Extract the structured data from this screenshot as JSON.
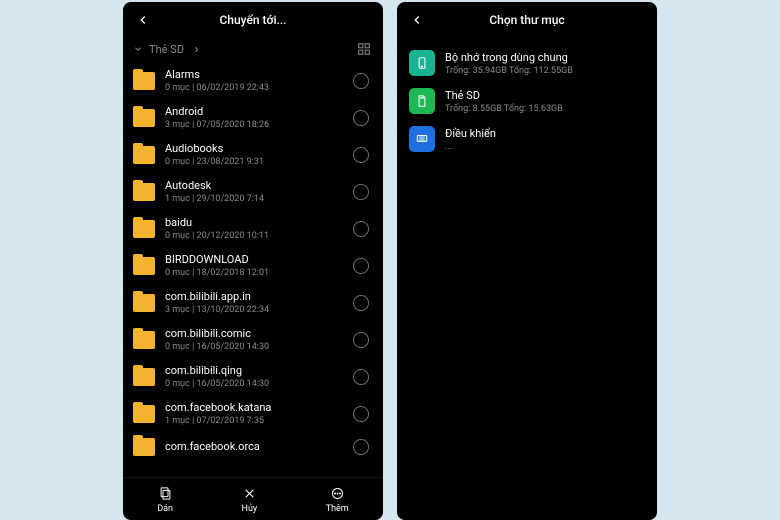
{
  "left": {
    "title": "Chuyển tới...",
    "breadcrumb": "Thẻ SD",
    "folders": [
      {
        "name": "Alarms",
        "meta": "0 mục | 06/02/2019 22:43"
      },
      {
        "name": "Android",
        "meta": "3 mục | 07/05/2020 18:26"
      },
      {
        "name": "Audiobooks",
        "meta": "0 mục | 23/08/2021 9:31"
      },
      {
        "name": "Autodesk",
        "meta": "1 mục | 29/10/2020 7:14"
      },
      {
        "name": "baidu",
        "meta": "0 mục | 20/12/2020 10:11"
      },
      {
        "name": "BIRDDOWNLOAD",
        "meta": "0 mục | 18/02/2018 12:01"
      },
      {
        "name": "com.bilibili.app.in",
        "meta": "3 mục | 13/10/2020 22:34"
      },
      {
        "name": "com.bilibili.comic",
        "meta": "0 mục | 16/05/2020 14:30"
      },
      {
        "name": "com.bilibili.qing",
        "meta": "0 mục | 16/05/2020 14:30"
      },
      {
        "name": "com.facebook.katana",
        "meta": "1 mục | 07/02/2019 7:35"
      },
      {
        "name": "com.facebook.orca",
        "meta": ""
      }
    ],
    "actions": {
      "paste": "Dán",
      "cancel": "Hủy",
      "more": "Thêm"
    }
  },
  "right": {
    "title": "Chọn thư mục",
    "items": [
      {
        "icon": "teal",
        "name": "Bộ nhớ trong dùng chung",
        "meta": "Trống: 35.94GB Tổng: 112.55GB"
      },
      {
        "icon": "green",
        "name": "Thẻ SD",
        "meta": "Trống: 8.55GB Tổng: 15.63GB"
      },
      {
        "icon": "blue",
        "name": "Điều khiển",
        "meta": "..."
      }
    ]
  }
}
